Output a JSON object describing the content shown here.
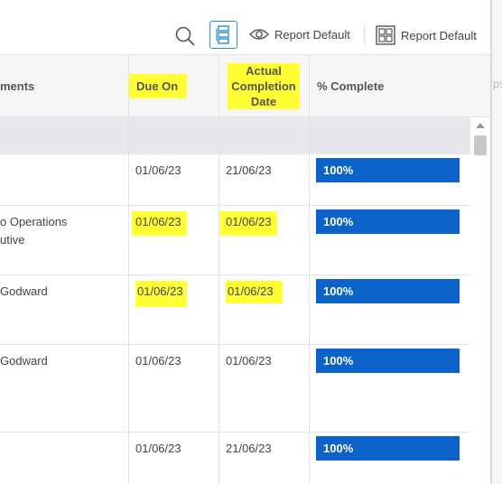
{
  "toolbar": {
    "views_label": "Report Default",
    "layout_label": "Report Default"
  },
  "ghost_header": "ps",
  "columns": {
    "comments": "ments",
    "due_on": "Due On",
    "actual_completion": [
      "Actual",
      "Completion",
      "Date"
    ],
    "pct_complete": "% Complete"
  },
  "rows": [
    {
      "comment_lines": [
        ""
      ],
      "due": "01/06/23",
      "actual": "21/06/23",
      "pct": "100%"
    },
    {
      "comment_lines": [
        "o Operations",
        "utive"
      ],
      "due": "01/06/23",
      "actual": "01/06/23",
      "pct": "100%"
    },
    {
      "comment_lines": [
        "Godward"
      ],
      "due": "01/06/23",
      "actual": "01/06/23",
      "pct": "100%"
    },
    {
      "comment_lines": [
        "Godward"
      ],
      "due": "01/06/23",
      "actual": "01/06/23",
      "pct": "100%"
    },
    {
      "comment_lines": [
        ""
      ],
      "due": "01/06/23",
      "actual": "21/06/23",
      "pct": "100%"
    }
  ],
  "colors": {
    "progress": "#0b63c9",
    "highlight": "#ffff33",
    "accent": "#2b8fcf"
  }
}
